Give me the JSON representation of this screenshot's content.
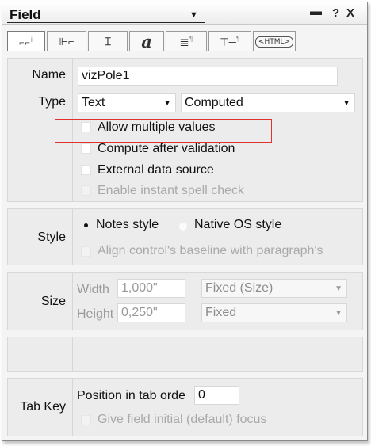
{
  "panel": {
    "title": "Field",
    "title_dropdown_icon": "caret-down",
    "minimize_label": "▬",
    "help_label": "?",
    "close_label": "X"
  },
  "tabs": [
    {
      "label": "i",
      "icon": "field-info-icon"
    },
    {
      "label": "",
      "icon": "field-control-icon"
    },
    {
      "label": "",
      "icon": "hide-when-icon"
    },
    {
      "label": "a",
      "icon": "font-icon"
    },
    {
      "label": "¶",
      "icon": "paragraph-alignment-icon"
    },
    {
      "label": "¶",
      "icon": "paragraph-margin-icon"
    },
    {
      "label": "HTML",
      "icon": "html-tag-icon"
    }
  ],
  "basics": {
    "name_label": "Name",
    "name_value": "vizPole1",
    "type_label": "Type",
    "type_value": "Text",
    "type_mode_value": "Computed",
    "options": [
      {
        "label": "Allow multiple values",
        "checked": false,
        "enabled": true
      },
      {
        "label": "Compute after validation",
        "checked": false,
        "enabled": true
      },
      {
        "label": "External data source",
        "checked": false,
        "enabled": true
      },
      {
        "label": "Enable instant spell check",
        "checked": false,
        "enabled": false
      }
    ]
  },
  "style": {
    "label": "Style",
    "radio_notes": "Notes style",
    "radio_native": "Native OS style",
    "selected": "Notes style",
    "align_label": "Align control's baseline with paragraph's"
  },
  "size": {
    "label": "Size",
    "width_label": "Width",
    "width_value": "1,000\"",
    "width_mode": "Fixed (Size)",
    "height_label": "Height",
    "height_value": "0,250\"",
    "height_mode": "Fixed"
  },
  "tabkey": {
    "label": "Tab Key",
    "position_label": "Position in tab orde",
    "position_value": "0",
    "focus_label": "Give field initial (default) focus"
  },
  "colors": {
    "highlight": "#e0332f",
    "section_bg": "#ececec",
    "disabled_text": "#a9a9a9"
  }
}
